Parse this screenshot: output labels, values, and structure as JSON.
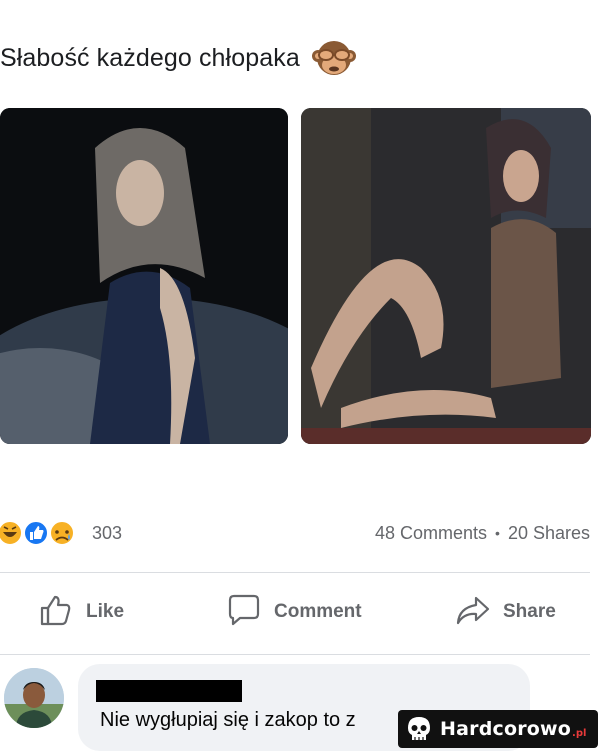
{
  "post": {
    "title": "Słabość każdego chłopaka",
    "title_emoji": "see-no-evil-monkey-icon"
  },
  "photos": [
    {
      "name": "photo-left",
      "palette": [
        "#0b0d10",
        "#2a3b55",
        "#c9c9c9"
      ]
    },
    {
      "name": "photo-right",
      "palette": [
        "#2b2b2e",
        "#6b5a4e",
        "#b49a86"
      ]
    }
  ],
  "reactions": {
    "icons": [
      "laughing-reaction-icon",
      "like-reaction-icon",
      "sad-reaction-icon"
    ],
    "count": "303"
  },
  "engagement": {
    "comments": "48 Comments",
    "separator": "•",
    "shares": "20 Shares"
  },
  "actions": {
    "like": "Like",
    "comment": "Comment",
    "share": "Share"
  },
  "comment": {
    "text": "Nie wygłupiaj się i zakop to z"
  },
  "watermark": {
    "name": "Hardcorowo",
    "tld": ".pl"
  },
  "colors": {
    "secondary_text": "#65676b",
    "bubble_bg": "#f0f2f5",
    "divider": "#dadde1",
    "like_blue": "#1877f2",
    "reaction_yellow": "#f7b125"
  }
}
